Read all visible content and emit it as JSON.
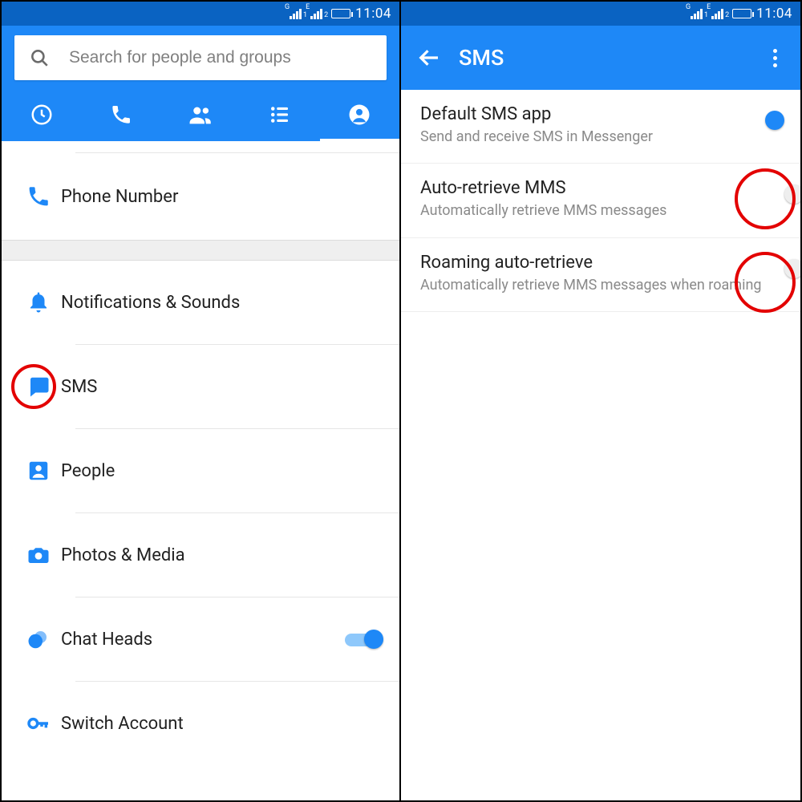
{
  "status": {
    "time": "11:04"
  },
  "left": {
    "search_placeholder": "Search for people and groups",
    "items": {
      "phone": "Phone Number",
      "notifications": "Notifications & Sounds",
      "sms": "SMS",
      "people": "People",
      "photos": "Photos & Media",
      "chat_heads": "Chat Heads",
      "switch_account": "Switch Account"
    },
    "chat_heads_on": true
  },
  "right": {
    "title": "SMS",
    "settings": {
      "default": {
        "title": "Default SMS app",
        "sub": "Send and receive SMS in Messenger",
        "on": true
      },
      "auto": {
        "title": "Auto-retrieve MMS",
        "sub": "Automatically retrieve MMS messages",
        "on": false
      },
      "roaming": {
        "title": "Roaming auto-retrieve",
        "sub": "Automatically retrieve MMS messages when roaming",
        "on": false
      }
    }
  }
}
